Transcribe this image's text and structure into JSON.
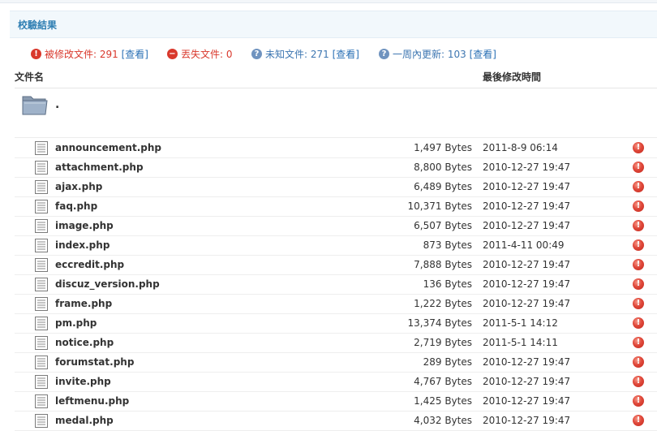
{
  "panel": {
    "title": "校驗結果"
  },
  "summary": {
    "modified": {
      "text": "被修改文件: 291",
      "link": "[查看]",
      "color": "#d9382c"
    },
    "missing": {
      "text": "丟失文件: 0",
      "color": "#d9382c"
    },
    "unknown": {
      "text": "未知文件: 271",
      "link": "[查看]",
      "color": "#3d76b1"
    },
    "weekly": {
      "text": "一周內更新: 103",
      "link": "[查看]",
      "color": "#3d76b1"
    }
  },
  "table": {
    "col_filename": "文件名",
    "col_modified": "最後修改時間",
    "folder": {
      "name": "."
    },
    "rows": [
      {
        "name": "announcement.php",
        "size": "1,497 Bytes",
        "time": "2011-8-9 06:14"
      },
      {
        "name": "attachment.php",
        "size": "8,800 Bytes",
        "time": "2010-12-27 19:47"
      },
      {
        "name": "ajax.php",
        "size": "6,489 Bytes",
        "time": "2010-12-27 19:47"
      },
      {
        "name": "faq.php",
        "size": "10,371 Bytes",
        "time": "2010-12-27 19:47"
      },
      {
        "name": "image.php",
        "size": "6,507 Bytes",
        "time": "2010-12-27 19:47"
      },
      {
        "name": "index.php",
        "size": "873 Bytes",
        "time": "2011-4-11 00:49"
      },
      {
        "name": "eccredit.php",
        "size": "7,888 Bytes",
        "time": "2010-12-27 19:47"
      },
      {
        "name": "discuz_version.php",
        "size": "136 Bytes",
        "time": "2010-12-27 19:47"
      },
      {
        "name": "frame.php",
        "size": "1,222 Bytes",
        "time": "2010-12-27 19:47"
      },
      {
        "name": "pm.php",
        "size": "13,374 Bytes",
        "time": "2011-5-1 14:12"
      },
      {
        "name": "notice.php",
        "size": "2,719 Bytes",
        "time": "2011-5-1 14:11"
      },
      {
        "name": "forumstat.php",
        "size": "289 Bytes",
        "time": "2010-12-27 19:47"
      },
      {
        "name": "invite.php",
        "size": "4,767 Bytes",
        "time": "2010-12-27 19:47"
      },
      {
        "name": "leftmenu.php",
        "size": "1,425 Bytes",
        "time": "2010-12-27 19:47"
      },
      {
        "name": "medal.php",
        "size": "4,032 Bytes",
        "time": "2010-12-27 19:47"
      }
    ],
    "status_icon": "alert-circle-icon"
  }
}
